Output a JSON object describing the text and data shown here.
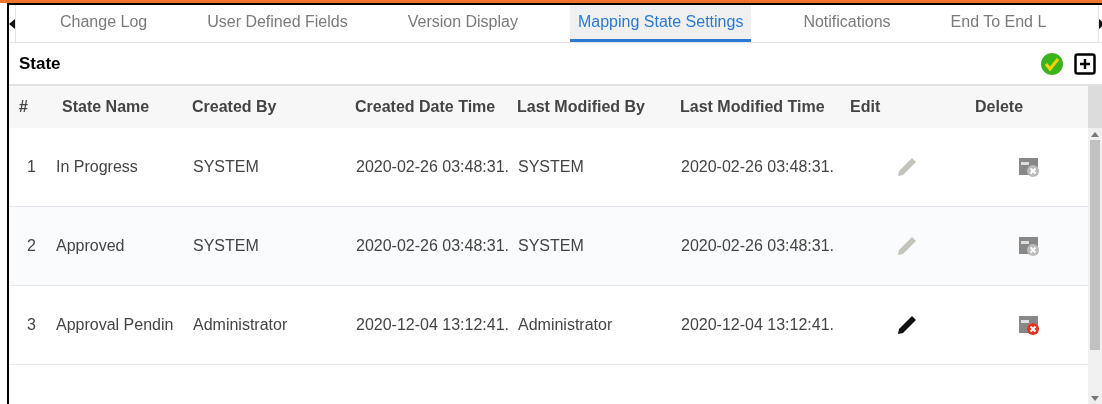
{
  "tabs": [
    {
      "label": "Change Log",
      "selected": false
    },
    {
      "label": "User Defined Fields",
      "selected": false
    },
    {
      "label": "Version Display",
      "selected": false
    },
    {
      "label": "Mapping State Settings",
      "selected": true
    },
    {
      "label": "Notifications",
      "selected": false
    },
    {
      "label": "End To End L",
      "selected": false
    }
  ],
  "panel": {
    "title": "State"
  },
  "table": {
    "columns": [
      "#",
      "State Name",
      "Created By",
      "Created Date Time",
      "Last Modified By",
      "Last Modified Time",
      "Edit",
      "Delete"
    ],
    "rows": [
      {
        "number": "1",
        "state_name": "In Progress",
        "created_by": "SYSTEM",
        "created": "2020-02-26 03:48:31.",
        "modified_by": "SYSTEM",
        "modified": "2020-02-26 03:48:31.",
        "editable": false
      },
      {
        "number": "2",
        "state_name": "Approved",
        "created_by": "SYSTEM",
        "created": "2020-02-26 03:48:31.",
        "modified_by": "SYSTEM",
        "modified": "2020-02-26 03:48:31.",
        "editable": false
      },
      {
        "number": "3",
        "state_name": "Approval Pendin",
        "created_by": "Administrator",
        "created": "2020-12-04 13:12:41.",
        "modified_by": "Administrator",
        "modified": "2020-12-04 13:12:41.",
        "editable": true
      }
    ]
  }
}
